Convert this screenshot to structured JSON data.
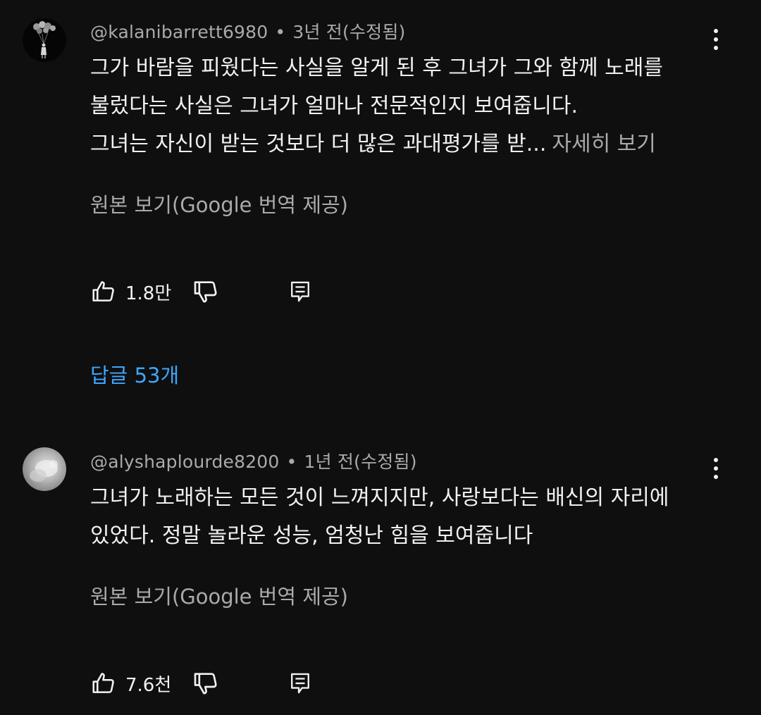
{
  "comments": [
    {
      "author": "@kalanibarrett6980",
      "separator": "•",
      "time": "3년 전(수정됨)",
      "lines": [
        "그가 바람을 피웠다는 사실을 알게 된 후 그녀가 그와 함께 노래를",
        "불렀다는 사실은 그녀가 얼마나 전문적인지 보여줍니다.",
        "그녀는 자신이 받는 것보다 더 많은 과대평가를 받..."
      ],
      "read_more": "자세히 보기",
      "translate_link": "원본 보기(Google 번역 제공)",
      "like_count": "1.8만",
      "replies": "답글 53개",
      "icons": {
        "like": "thumbs-up-icon",
        "dislike": "thumbs-down-icon",
        "reply": "reply-icon",
        "menu": "more-vert-icon"
      }
    },
    {
      "author": "@alyshaplourde8200",
      "separator": "•",
      "time": "1년 전(수정됨)",
      "lines": [
        "그녀가 노래하는 모든 것이 느껴지지만, 사랑보다는 배신의 자리에",
        "있었다. 정말 놀라운 성능, 엄청난 힘을 보여줍니다"
      ],
      "translate_link": "원본 보기(Google 번역 제공)",
      "like_count": "7.6천",
      "icons": {
        "like": "thumbs-up-icon",
        "dislike": "thumbs-down-icon",
        "reply": "reply-icon",
        "menu": "more-vert-icon"
      }
    }
  ],
  "colors": {
    "background": "#0f0f0f",
    "text_primary": "#f1f1f1",
    "text_secondary": "#aaaaaa",
    "link_blue": "#3ea6ff"
  }
}
